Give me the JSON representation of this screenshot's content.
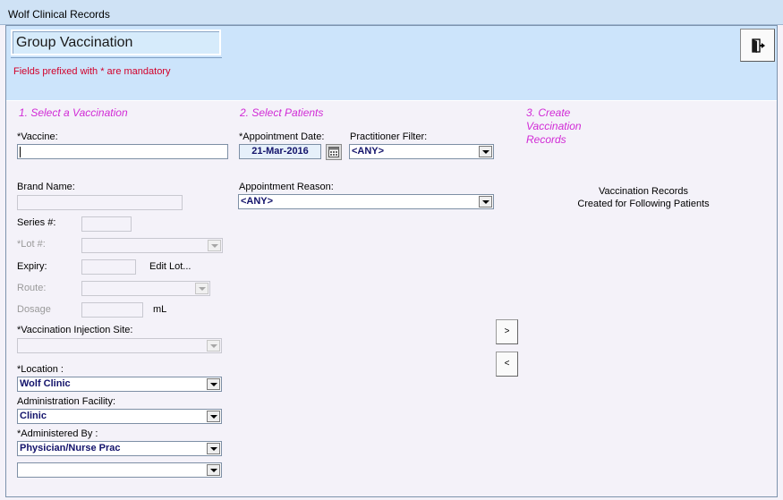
{
  "window": {
    "title": "Wolf Clinical Records"
  },
  "header": {
    "page_title": "Group Vaccination",
    "mandatory_note": "Fields prefixed with * are mandatory",
    "exit_icon": "exit-door-icon"
  },
  "section1": {
    "heading": "1. Select a Vaccination",
    "vaccine_label": "*Vaccine:",
    "vaccine_value": "",
    "brand_label": "Brand Name:",
    "brand_value": "",
    "series_label": "Series #:",
    "series_value": "",
    "lot_label": "*Lot #:",
    "lot_value": "",
    "expiry_label": "Expiry:",
    "expiry_value": "",
    "edit_lot_label": "Edit Lot...",
    "route_label": "Route:",
    "route_value": "",
    "dosage_label": "Dosage",
    "dosage_value": "",
    "dosage_unit": "mL",
    "site_label": "*Vaccination Injection Site:",
    "site_value": "",
    "location_label": "*Location :",
    "location_value": "Wolf Clinic",
    "facility_label": "Administration Facility:",
    "facility_value": "Clinic",
    "administered_label": "*Administered By :",
    "administered_value": "Physician/Nurse Prac",
    "administered_name_value": ""
  },
  "section2": {
    "heading": "2. Select Patients",
    "appt_date_label": "*Appointment Date:",
    "appt_date_value": "21-Mar-2016",
    "calendar_icon": "calendar-icon",
    "practitioner_label": "Practitioner Filter:",
    "practitioner_value": "<ANY>",
    "reason_label": "Appointment Reason:",
    "reason_value": "<ANY>"
  },
  "transfer": {
    "add_label": ">",
    "remove_label": "<"
  },
  "section3": {
    "heading_line1": "3. Create",
    "heading_line2": "Vaccination",
    "heading_line3": "Records",
    "created_line1": "Vaccination Records",
    "created_line2": "Created for Following Patients"
  }
}
